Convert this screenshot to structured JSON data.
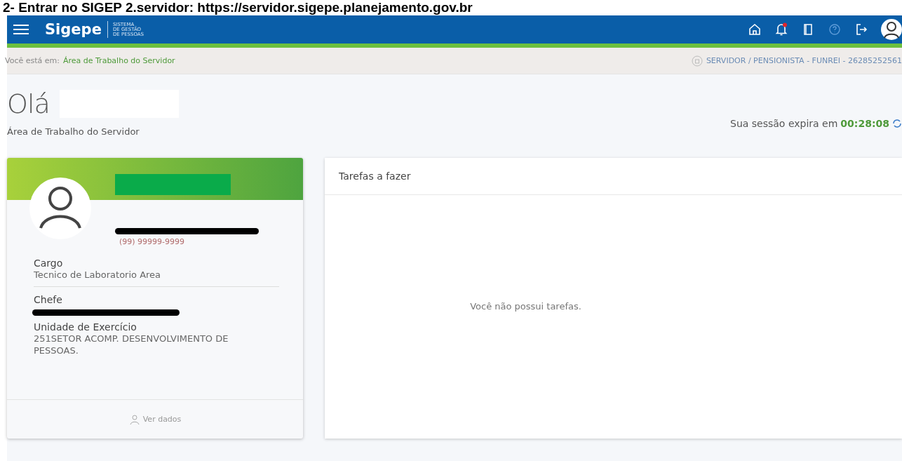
{
  "caption": "2- Entrar no SIGEP 2.servidor: https://servidor.sigepe.planejamento.gov.br",
  "header": {
    "brand": "Sigepe",
    "brand_sub": [
      "SISTEMA",
      "DE GESTÃO",
      "DE PESSOAS"
    ],
    "notification": true
  },
  "breadcrumb": {
    "label": "Você está em:",
    "current": "Área de Trabalho do Servidor",
    "profile": "SERVIDOR / PENSIONISTA - FUNREI - 26285252561"
  },
  "greeting": "Olá",
  "subtitle": "Área de Trabalho do Servidor",
  "session": {
    "label": "Sua sessão expira em",
    "time": "00:28:08"
  },
  "profile_card": {
    "phone": "(99) 99999-9999",
    "fields": [
      {
        "label": "Cargo",
        "value": "Tecnico de Laboratorio Area"
      },
      {
        "label": "Chefe"
      },
      {
        "label": "Unidade de Exercício",
        "value": "251SETOR ACOMP. DESENVOLVIMENTO DE PESSOAS."
      }
    ],
    "footer": "Ver dados"
  },
  "tasks": {
    "title": "Tarefas a fazer",
    "empty": "Você não possui tarefas."
  }
}
